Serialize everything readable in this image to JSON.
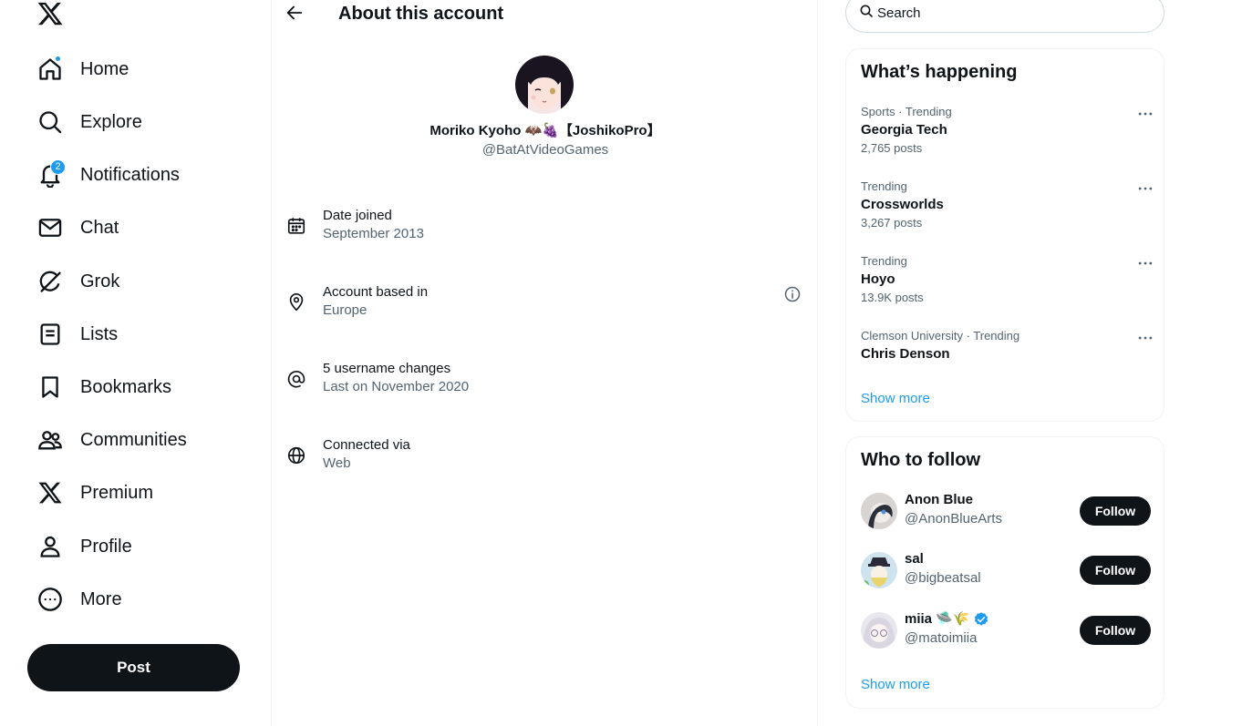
{
  "nav": {
    "items": [
      {
        "key": "home",
        "label": "Home"
      },
      {
        "key": "explore",
        "label": "Explore"
      },
      {
        "key": "notifications",
        "label": "Notifications",
        "badge": "2"
      },
      {
        "key": "chat",
        "label": "Chat"
      },
      {
        "key": "grok",
        "label": "Grok"
      },
      {
        "key": "lists",
        "label": "Lists"
      },
      {
        "key": "bookmarks",
        "label": "Bookmarks"
      },
      {
        "key": "communities",
        "label": "Communities"
      },
      {
        "key": "premium",
        "label": "Premium"
      },
      {
        "key": "profile",
        "label": "Profile"
      },
      {
        "key": "more",
        "label": "More"
      }
    ],
    "post_label": "Post"
  },
  "header": {
    "title": "About this account"
  },
  "profile": {
    "display_name": "Moriko Kyoho 🦇🍇【JoshikoPro】",
    "handle": "@BatAtVideoGames"
  },
  "info": [
    {
      "label": "Date joined",
      "value": "September 2013",
      "icon": "calendar-icon"
    },
    {
      "label": "Account based in",
      "value": "Europe",
      "icon": "location-pin-icon"
    },
    {
      "label": "5 username changes",
      "value": "Last on November 2020",
      "icon": "at-sign-icon"
    },
    {
      "label": "Connected via",
      "value": "Web",
      "icon": "globe-icon"
    }
  ],
  "search": {
    "placeholder": "Search"
  },
  "trending": {
    "title": "What’s happening",
    "items": [
      {
        "meta": "Sports · Trending",
        "name": "Georgia Tech",
        "count": "2,765 posts"
      },
      {
        "meta": "Trending",
        "name": "Crossworlds",
        "count": "3,267 posts"
      },
      {
        "meta": "Trending",
        "name": "Hoyo",
        "count": "13.9K posts"
      },
      {
        "meta": "Clemson University · Trending",
        "name": "Chris Denson",
        "count": ""
      }
    ],
    "show_more": "Show more"
  },
  "who_to_follow": {
    "title": "Who to follow",
    "items": [
      {
        "name": "Anon Blue",
        "handle": "@AnonBlueArts",
        "button": "Follow"
      },
      {
        "name": "sal",
        "handle": "@bigbeatsal",
        "button": "Follow"
      },
      {
        "name": "miia 🛸🌾",
        "handle": "@matoimiia",
        "button": "Follow",
        "verified": true
      }
    ],
    "show_more": "Show more"
  },
  "colors": {
    "accent": "#1d9bf0",
    "text": "#0f1419",
    "muted": "#536471",
    "border": "#eff3f4"
  }
}
